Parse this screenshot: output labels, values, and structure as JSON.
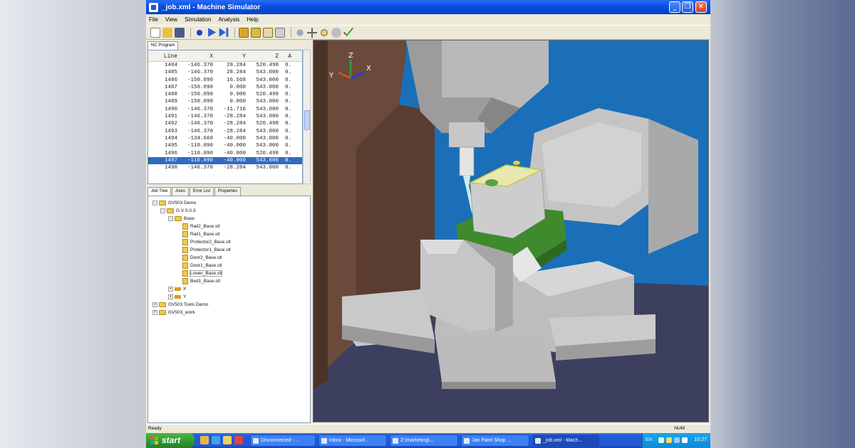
{
  "window": {
    "title": "_job.xml - Machine Simulator",
    "minimize": "_",
    "maximize": "❐",
    "close": "✕"
  },
  "menu": [
    "File",
    "View",
    "Simulation",
    "Analysis",
    "Help"
  ],
  "toolbar_icons": [
    "new-file-icon",
    "open-folder-icon",
    "save-icon",
    "reset-icon",
    "play-icon",
    "step-icon",
    "view-front-icon",
    "view-top-icon",
    "view-side-icon",
    "view-iso-icon",
    "zoom-icon",
    "pan-icon",
    "rotate-icon",
    "fit-icon",
    "check-icon"
  ],
  "nc_panel": {
    "tab": "NC Program",
    "columns": [
      "Line",
      "X",
      "Y",
      "Z",
      "A"
    ],
    "rows": [
      [
        "1484",
        "-146.370",
        "28.284",
        "520.498",
        "0."
      ],
      [
        "1485",
        "-146.370",
        "28.284",
        "543.000",
        "0."
      ],
      [
        "1486",
        "-150.090",
        "16.568",
        "543.000",
        "0."
      ],
      [
        "1487",
        "-150.090",
        "0.000",
        "543.000",
        "0."
      ],
      [
        "1488",
        "-150.090",
        "0.000",
        "520.498",
        "0."
      ],
      [
        "1489",
        "-150.090",
        "0.000",
        "543.000",
        "0."
      ],
      [
        "1490",
        "-146.370",
        "-11.716",
        "543.000",
        "0."
      ],
      [
        "1491",
        "-146.370",
        "-28.284",
        "543.000",
        "0."
      ],
      [
        "1492",
        "-146.370",
        "-28.284",
        "520.498",
        "0."
      ],
      [
        "1493",
        "-146.370",
        "-28.284",
        "543.000",
        "0."
      ],
      [
        "1494",
        "-134.660",
        "-40.000",
        "543.000",
        "0."
      ],
      [
        "1495",
        "-110.090",
        "-40.000",
        "543.000",
        "0."
      ],
      [
        "1496",
        "-110.090",
        "-40.000",
        "520.498",
        "0."
      ],
      [
        "1497",
        "-110.090",
        "-40.000",
        "543.000",
        "0."
      ],
      [
        "1498",
        "-146.370",
        "-28.284",
        "543.000",
        "0."
      ]
    ],
    "selected_row": 13
  },
  "tree_panel": {
    "tabs": [
      "Job Tree",
      "Axes",
      "Error List",
      "Properties"
    ],
    "nodes": [
      {
        "label": "GV503 Demo",
        "kind": "folder",
        "level": 0,
        "expander": "−"
      },
      {
        "label": "G V 5.0.3",
        "kind": "folder",
        "level": 1,
        "expander": "−"
      },
      {
        "label": "Base",
        "kind": "folder",
        "level": 2,
        "expander": "−"
      },
      {
        "label": "Rail2_Base.stl",
        "kind": "file",
        "level": 3
      },
      {
        "label": "Rail1_Base.stl",
        "kind": "file",
        "level": 3
      },
      {
        "label": "Protector2_Base.stl",
        "kind": "file",
        "level": 3
      },
      {
        "label": "Protector1_Base.stl",
        "kind": "file",
        "level": 3
      },
      {
        "label": "Door2_Base.stl",
        "kind": "file",
        "level": 3
      },
      {
        "label": "Door1_Base.stl",
        "kind": "file",
        "level": 3
      },
      {
        "label": "Lower_Base.stl",
        "kind": "file",
        "level": 3
      },
      {
        "label": "Bed1_Base.stl",
        "kind": "file",
        "level": 3
      },
      {
        "label": "X",
        "kind": "tool",
        "level": 2,
        "expander": "+"
      },
      {
        "label": "Y",
        "kind": "tool",
        "level": 2,
        "expander": "+"
      },
      {
        "label": "GV503 Tools Demo",
        "kind": "folder",
        "level": 0,
        "expander": "+"
      },
      {
        "label": "GV503_work",
        "kind": "folder",
        "level": 0,
        "expander": "+"
      }
    ],
    "highlighted": 9
  },
  "viewport": {
    "axis_labels": {
      "z": "Z",
      "x": "X",
      "y": "Y"
    }
  },
  "status": {
    "left": "Ready",
    "right": "NUM"
  },
  "taskbar": {
    "start": "start",
    "tasks": [
      "Disconnected - ...",
      "Inbox - Microsof...",
      "Z:\\marketing\\...",
      "Jan Paint Shop ...",
      "_job.xml - Mach..."
    ],
    "active_task": 4,
    "lang": "EN",
    "clock": "10:27"
  },
  "colors": {
    "title_blue": "#0a4fe0",
    "viewport_bg": "#1a6fb8",
    "machine_gray": "#b6b6b6",
    "fixture_green": "#3f8a2c",
    "selection": "#316ac5",
    "start_green": "#2f962c"
  }
}
